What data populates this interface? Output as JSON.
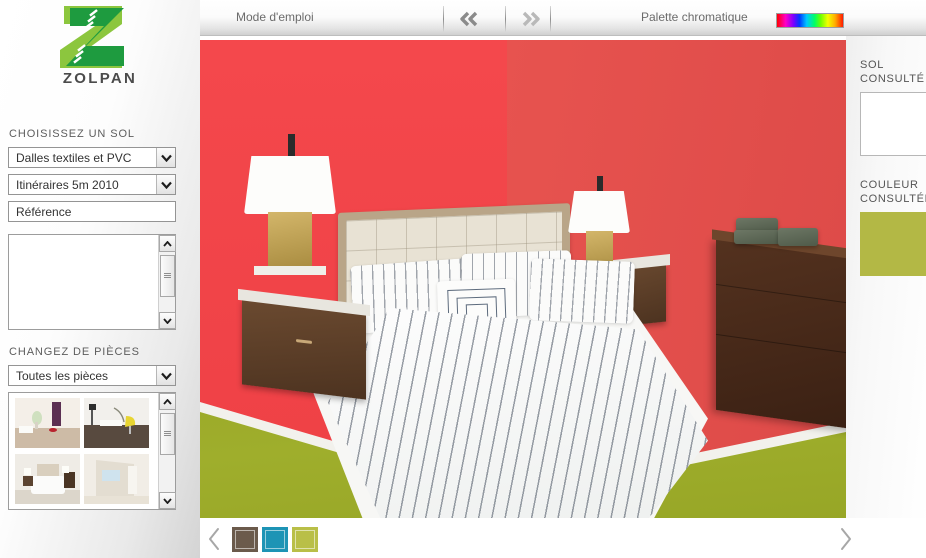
{
  "brand": {
    "name": "ZOLPAN",
    "logo_icon": "zolpan-z-logo-icon",
    "logo_green_dark": "#1e9b3f",
    "logo_green_light": "#8cc63e"
  },
  "sidebar": {
    "floor_section": {
      "heading": "CHOISISSEZ UN SOL",
      "selects": [
        {
          "name": "floor-family-select",
          "value": "Dalles textiles et PVC",
          "icon": "chevron-down-icon"
        },
        {
          "name": "floor-collection-select",
          "value": "Itinéraires 5m 2010",
          "icon": "chevron-down-icon"
        }
      ],
      "reference_input": {
        "value": "Référence",
        "placeholder": "Référence"
      },
      "results_list": {
        "items": [],
        "scrollbar": {
          "up_icon": "chevron-up-icon",
          "down_icon": "chevron-down-icon",
          "grip_icon": "grip-icon"
        }
      }
    },
    "rooms_section": {
      "heading": "CHANGEZ DE PIÈCES",
      "select": {
        "value": "Toutes les pièces",
        "icon": "chevron-down-icon"
      },
      "thumbnails": [
        {
          "name": "room-thumb-living-purple",
          "alt": "Pièce claire avec rideau violet et plante"
        },
        {
          "name": "room-thumb-lounge-yellow-chair",
          "alt": "Salon avec fauteuil jaune et sol brun"
        },
        {
          "name": "room-thumb-bedroom",
          "alt": "Chambre avec lit double"
        },
        {
          "name": "room-thumb-empty-hallway",
          "alt": "Pièce vide avec couloir"
        }
      ],
      "scrollbar": {
        "up_icon": "chevron-up-icon",
        "down_icon": "chevron-down-icon",
        "grip_icon": "grip-icon"
      }
    }
  },
  "toolbar": {
    "help_label": "Mode d'emploi",
    "prev_icon": "double-chevron-left-icon",
    "next_icon": "double-chevron-right-icon",
    "palette_label": "Palette chromatique",
    "palette_icon": "rainbow-gradient-swatch-icon"
  },
  "right_panel": {
    "floor_label_line1": "SOL",
    "floor_label_line2": "CONSULTÉ",
    "floor_preview_value": "",
    "colour_label_line1": "COULEUR",
    "colour_label_line2": "CONSULTÉE",
    "colour_preview_hex": "#b3b845"
  },
  "bottom_bar": {
    "prev_icon": "chevron-left-icon",
    "next_icon": "chevron-right-icon",
    "swatches": [
      {
        "name": "swatch-brown",
        "hex": "#6b5a4b"
      },
      {
        "name": "swatch-teal",
        "hex": "#1d94b5"
      },
      {
        "name": "swatch-olive",
        "hex": "#b9bf47"
      }
    ],
    "footer_hint": ". . ."
  },
  "room_preview": {
    "alt": "Chambre avec mur corail, lit double rayé et sol vert olive",
    "wall_left_hex": "#f4484c",
    "wall_right_hex": "#e0504c",
    "floor_hex": "#9aa828",
    "baseboard_hex": "#f2f1ec",
    "bedding_hex": "#f8f8f6",
    "headboard_hex": "#e8e2d4",
    "wood_dark_hex": "#4d3320",
    "lamp_base_hex": "#c5a55c"
  }
}
